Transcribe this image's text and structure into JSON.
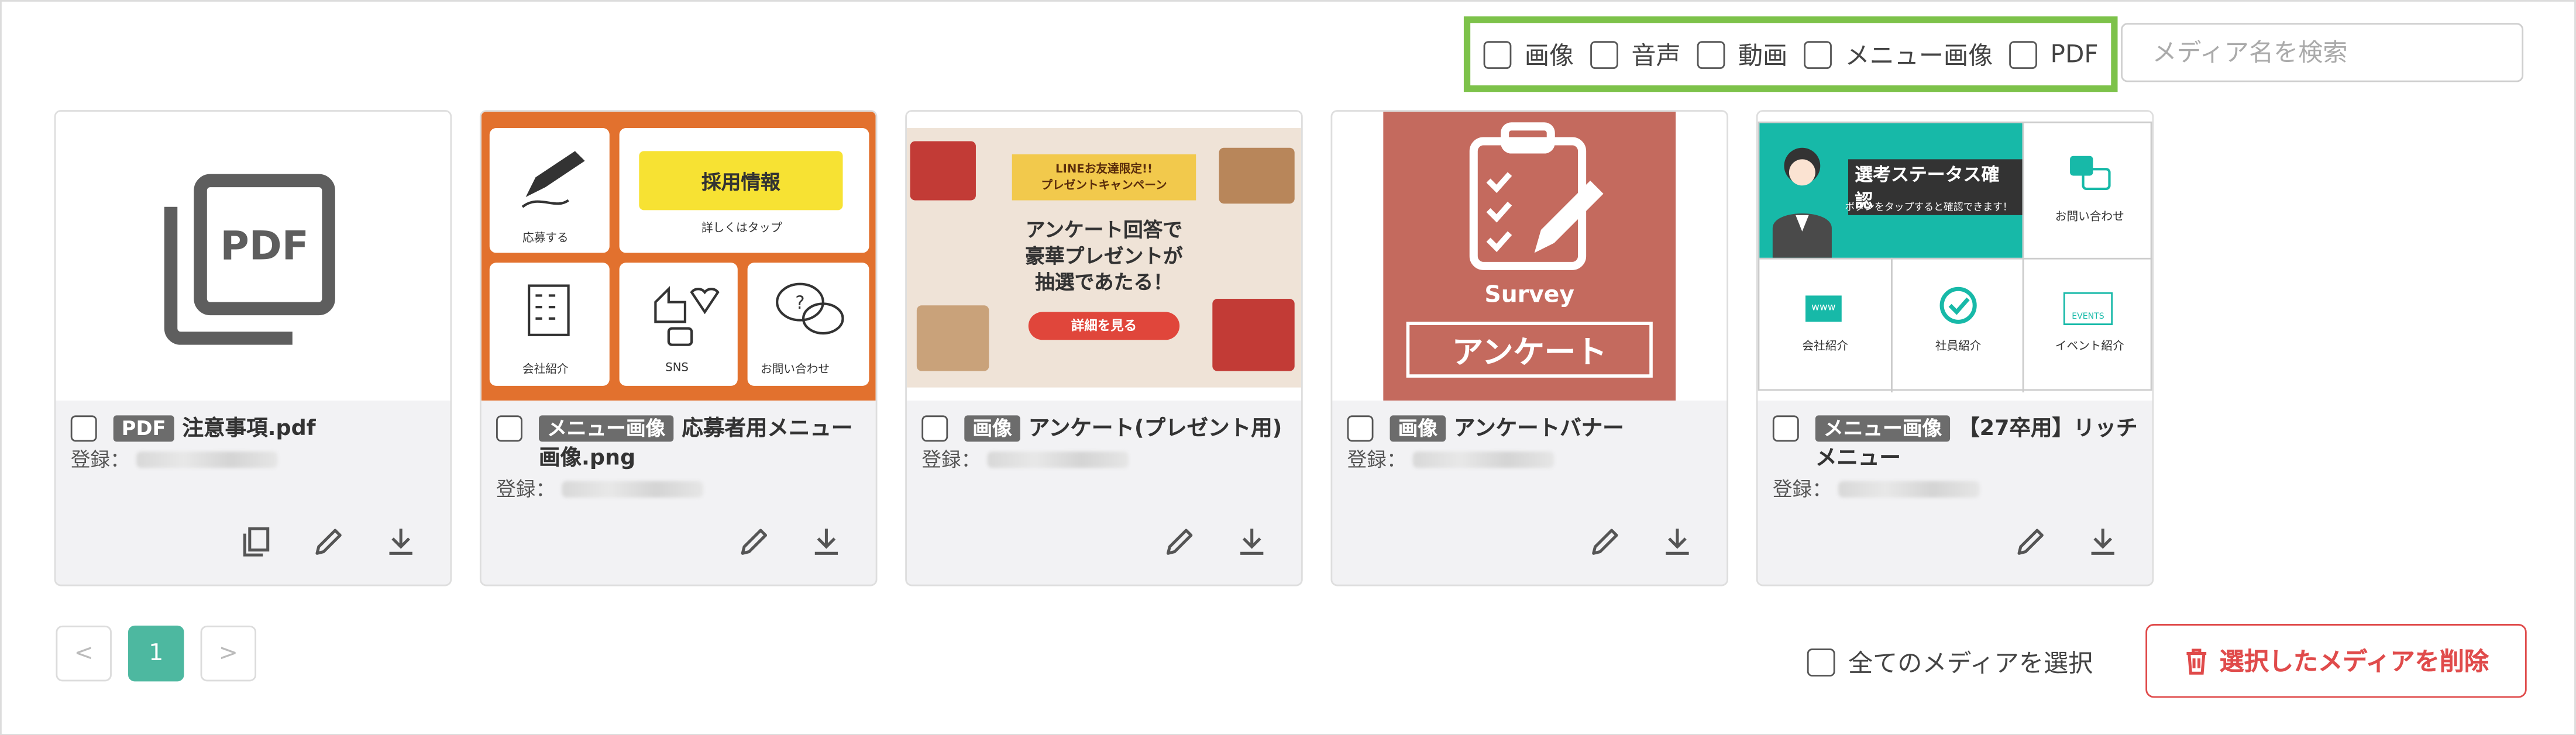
{
  "filters": [
    {
      "label": "画像"
    },
    {
      "label": "音声"
    },
    {
      "label": "動画"
    },
    {
      "label": "メニュー画像"
    },
    {
      "label": "PDF"
    }
  ],
  "search": {
    "placeholder": "メディア名を検索"
  },
  "cards": [
    {
      "badge": "PDF",
      "title": "注意事項.pdf",
      "reg_label": "登録：",
      "thumb_text": "PDF"
    },
    {
      "badge": "メニュー画像",
      "title": "応募者用メニュー画像.png",
      "reg_label": "登録：",
      "thumb": {
        "top_right": "採用情報",
        "top_right_sub": "詳しくはタップ",
        "top_left": "応募する",
        "b1": "会社紹介",
        "b2": "SNS",
        "b3": "お問い合わせ"
      }
    },
    {
      "badge": "画像",
      "title": "アンケート(プレゼント用)",
      "reg_label": "登録：",
      "thumb": {
        "ribbon1": "LINEお友達限定!!",
        "ribbon2": "プレゼントキャンペーン",
        "headline1": "アンケート回答で",
        "headline2": "豪華プレゼントが",
        "headline3": "抽選であたる！",
        "button": "詳細を見る"
      }
    },
    {
      "badge": "画像",
      "title": "アンケートバナー",
      "reg_label": "登録：",
      "thumb": {
        "survey": "Survey",
        "banner": "アンケート"
      }
    },
    {
      "badge": "メニュー画像",
      "title": "【27卒用】リッチメニュー",
      "reg_label": "登録：",
      "thumb": {
        "status": "選考ステータス確認",
        "status_sub": "ボタンをタップすると確認できます！",
        "contact": "お問い合わせ",
        "company": "会社紹介",
        "staff": "社員紹介",
        "event": "イベント紹介",
        "events_icon": "EVENTS",
        "www_icon": "www"
      }
    }
  ],
  "pagination": {
    "prev": "<",
    "current": "1",
    "next": ">"
  },
  "select_all": {
    "label": "全てのメディアを選択"
  },
  "delete_button": {
    "label": "選択したメディアを削除"
  },
  "colors": {
    "accent": "#4db8a0",
    "filter_border": "#7dc24a",
    "danger": "#e04b4b",
    "badge": "#6c6c6c"
  }
}
